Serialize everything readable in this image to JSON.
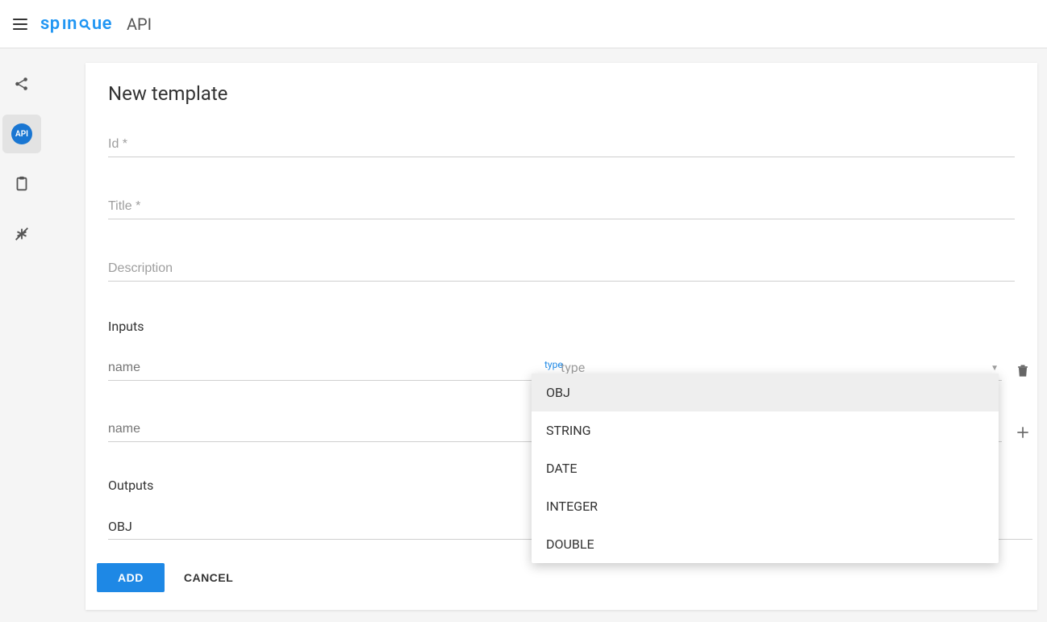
{
  "header": {
    "brand": "spinque",
    "context": "API"
  },
  "sidebar": {
    "items": [
      {
        "name": "share",
        "label": "Share"
      },
      {
        "name": "api",
        "label": "API"
      },
      {
        "name": "clipboard",
        "label": "Clipboard"
      },
      {
        "name": "filter",
        "label": "Filter"
      }
    ],
    "api_badge": "API"
  },
  "form": {
    "title": "New template",
    "fields": {
      "id_placeholder": "Id *",
      "title_placeholder": "Title *",
      "description_placeholder": "Description"
    },
    "inputs_label": "Inputs",
    "input_name_placeholder": "name",
    "input_type_placeholder": "type",
    "outputs_label": "Outputs",
    "outputs_value": "OBJ",
    "add_button": "ADD",
    "cancel_button": "CANCEL"
  },
  "dropdown": {
    "label": "type",
    "options": [
      "OBJ",
      "STRING",
      "DATE",
      "INTEGER",
      "DOUBLE"
    ],
    "selected": "OBJ"
  }
}
